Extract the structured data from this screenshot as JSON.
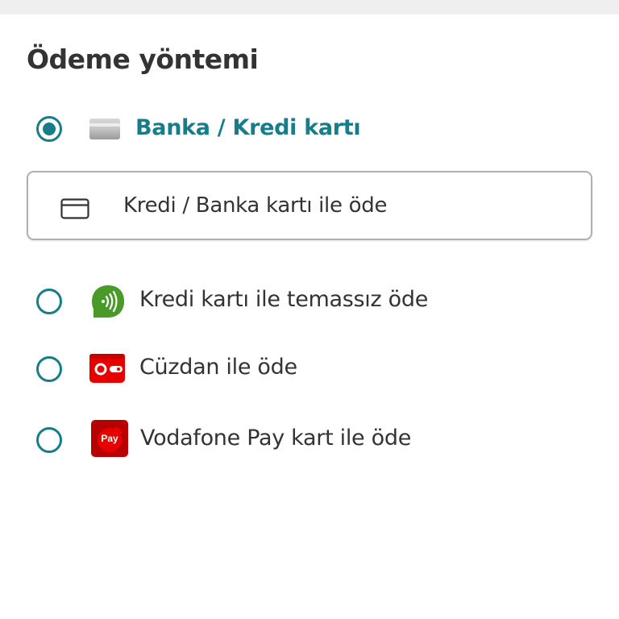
{
  "section": {
    "title": "Ödeme yöntemi"
  },
  "payment_options": [
    {
      "label": "Banka / Kredi kartı",
      "selected": true,
      "icon": "bank-card-icon"
    },
    {
      "label": "Kredi kartı ile temassız öde",
      "selected": false,
      "icon": "contactless-icon"
    },
    {
      "label": "Cüzdan ile öde",
      "selected": false,
      "icon": "wallet-icon"
    },
    {
      "label": "Vodafone Pay kart ile öde",
      "selected": false,
      "icon": "vodafone-pay-icon",
      "icon_text": "Pay"
    }
  ],
  "card_selector": {
    "label": "Kredi / Banka kartı ile öde",
    "icon": "credit-card-outline-icon"
  },
  "colors": {
    "accent": "#177e89",
    "text": "#333333",
    "contactless_green": "#4a9a2a",
    "wallet_red": "#e60000",
    "vodafone_red": "#c20000"
  }
}
